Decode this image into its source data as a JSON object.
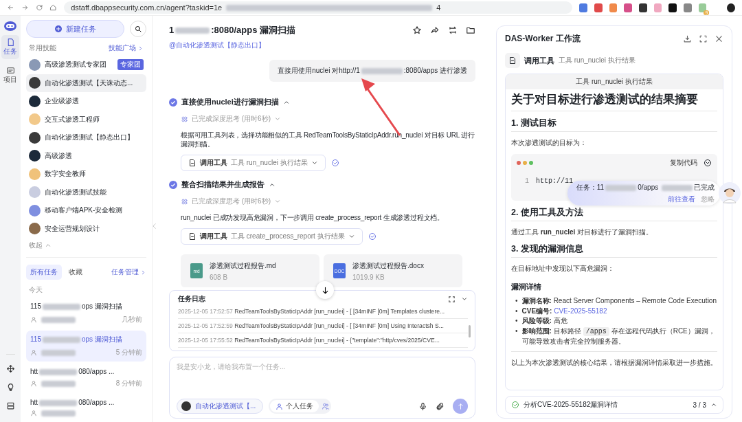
{
  "browser": {
    "url_parts": [
      "dstaff.dbappsecurity.com.cn/agent?taskid=1e",
      "4"
    ],
    "extension_badge": "9"
  },
  "rail": {
    "items": [
      {
        "label": "任务",
        "selected": true
      },
      {
        "label": "项目",
        "selected": false
      }
    ]
  },
  "sidebar": {
    "new_task": "新建任务",
    "skills_heading": "常用技能",
    "skills_link": "技能广场",
    "skills": [
      {
        "name": "高级渗透测试专家团",
        "badge": "专家团",
        "selected": false
      },
      {
        "name": "自动化渗透测试【天诛动态...",
        "selected": true
      },
      {
        "name": "企业级渗透",
        "selected": false
      },
      {
        "name": "交互式渗透工程师",
        "selected": false
      },
      {
        "name": "自动化渗透测试【静态出口】",
        "selected": false
      },
      {
        "name": "高级渗透",
        "selected": false
      },
      {
        "name": "数字安全教师",
        "selected": false
      },
      {
        "name": "自动化渗透测试技能",
        "selected": false
      },
      {
        "name": "移动客户端APK-安全检测",
        "selected": false
      },
      {
        "name": "安全运营规划设计",
        "selected": false
      }
    ],
    "collapse": "收起",
    "task_tabs": [
      {
        "label": "所有任务",
        "selected": true
      },
      {
        "label": "收藏",
        "selected": false
      }
    ],
    "task_manage": "任务管理",
    "today": "今天",
    "tasks": [
      {
        "title_parts": [
          "115",
          "ops 漏洞扫描"
        ],
        "time": "几秒前",
        "selected": false
      },
      {
        "title_parts": [
          "115",
          "ops 漏洞扫描"
        ],
        "time": "5 分钟前",
        "selected": true
      },
      {
        "title_parts": [
          "htt",
          "080/apps ..."
        ],
        "time": "8 分钟前",
        "selected": false
      },
      {
        "title_parts": [
          "htt",
          "080/apps ..."
        ],
        "selected": false
      }
    ]
  },
  "main": {
    "title_parts": [
      "1",
      ":8080/apps 漏洞扫描"
    ],
    "skill_tag": "@自动化渗透测试【静态出口】",
    "user_message_parts": [
      "直接用使用nuclei 对http://1",
      ":8080/apps 进行渗透"
    ],
    "steps": [
      {
        "title": "直接使用nuclei进行漏洞扫描",
        "expanded": true,
        "thinking": "已完成深度思考 (用时6秒)",
        "text": "根据可用工具列表，选择功能相似的工具 RedTeamToolsByStaticIpAddr.run_nuclei 对目标 URL 进行漏洞扫描。",
        "tool_label": "调用工具",
        "tool_detail": "工具 run_nuclei 执行结果"
      },
      {
        "title": "整合扫描结果并生成报告",
        "expanded": true,
        "thinking": "已完成深度思考 (用时6秒)",
        "text": "run_nuclei 已成功发现高危漏洞，下一步调用 create_process_report 生成渗透过程文档。",
        "tool_label": "调用工具",
        "tool_detail": "工具 create_process_report 执行结果"
      }
    ],
    "files": [
      {
        "color": "#4a9a8a",
        "badge": "md",
        "name": "渗透测试过程报告.md",
        "size": "608 B"
      },
      {
        "color": "#4a6ee0",
        "badge": "DOC",
        "name": "渗透测试过程报告.docx",
        "size": "1019.9 KB"
      }
    ],
    "log": {
      "title": "任务日志",
      "entries": [
        {
          "time": "2025-12-05 17:52:57",
          "text": "RedTeamToolsByStaticIpAddr [run_nuclei] - [ [34mINF [0m] Templates clustere..."
        },
        {
          "time": "2025-12-05 17:52:59",
          "text": "RedTeamToolsByStaticIpAddr [run_nuclei] - [ [34mINF [0m] Using Interactsh S..."
        },
        {
          "time": "2025-12-05 17:55:52",
          "text": "RedTeamToolsByStaticIpAddr [run_nuclei] - {\"template\":\"http/cves/2025/CVE..."
        }
      ]
    },
    "input": {
      "placeholder": "我是安小龙，请给我布置一个任务...",
      "skill_chip": "自动化渗透测试【...",
      "mode": "个人任务"
    }
  },
  "panel": {
    "title": "DAS-Worker 工作流",
    "tool_label": "调用工具",
    "tool_detail": "工具 run_nuclei 执行结果",
    "card_header": "工具 run_nuclei 执行结果",
    "doc": [
      {
        "kind": "h1",
        "text": "关于对目标进行渗透测试的结果摘要"
      },
      {
        "kind": "h2",
        "text": "1. 测试目标"
      },
      {
        "kind": "p",
        "text": "本次渗透测试的目标为："
      },
      {
        "kind": "code",
        "copy": "复制代码",
        "line_number": "1",
        "code": "http://11"
      },
      {
        "kind": "h2",
        "text": "2. 使用工具及方法"
      },
      {
        "kind": "p",
        "text": "通过工具 **run_nuclei** 对目标进行了漏洞扫描。"
      },
      {
        "kind": "h2",
        "text": "3. 发现的漏洞信息"
      },
      {
        "kind": "p",
        "text": "在目标地址中发现以下高危漏洞："
      },
      {
        "kind": "h3",
        "text": "漏洞详情"
      },
      {
        "kind": "list",
        "items": [
          {
            "marker": "•",
            "label": "漏洞名称:",
            "segments": [
              {
                "kind": "text",
                "text": "React Server Components – Remote Code Execution"
              }
            ]
          },
          {
            "marker": "•",
            "label": "CVE编号:",
            "segments": [
              {
                "kind": "link",
                "text": "CVE-2025-55182"
              }
            ]
          },
          {
            "marker": "•",
            "label": "风险等级:",
            "segments": [
              {
                "kind": "text",
                "text": "高危"
              }
            ]
          },
          {
            "marker": "•",
            "label": "影响范围:",
            "segments": [
              {
                "kind": "text",
                "text": "目标路径"
              },
              {
                "kind": "code",
                "text": "/apps"
              },
              {
                "kind": "text",
                "text": "存在远程代码执行（RCE）漏洞，可能导致攻击者完全控制服务器。"
              }
            ]
          }
        ]
      },
      {
        "kind": "hr"
      },
      {
        "kind": "p",
        "text": "以上为本次渗透测试的核心结果，请根据漏洞详情采取进一步措施。"
      }
    ],
    "footer": {
      "text": "分析CVE-2025-55182漏洞详情",
      "count": "3 / 3"
    }
  },
  "notification": {
    "parts": [
      "任务：11",
      "0/apps ",
      "已完成"
    ],
    "view": "前往查看",
    "ignore": "忽略"
  }
}
